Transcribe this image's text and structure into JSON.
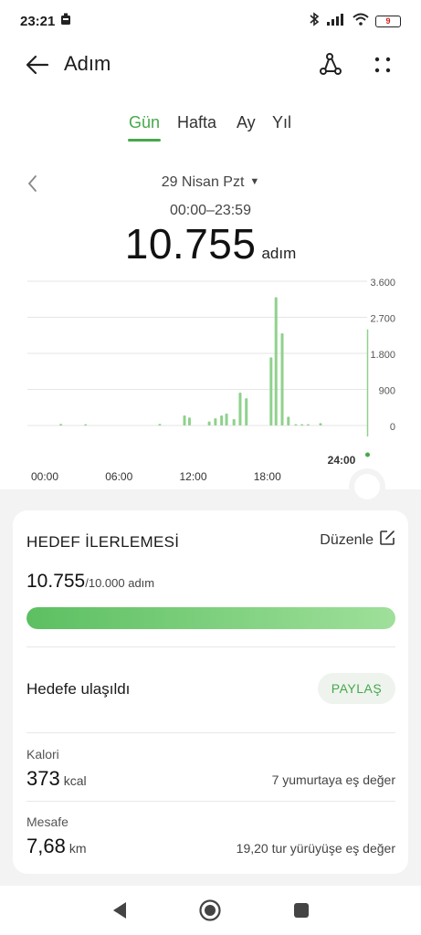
{
  "status_bar": {
    "time": "23:21",
    "battery": "9"
  },
  "app_bar": {
    "title": "Adım"
  },
  "tabs": [
    {
      "label": "Gün",
      "active": true
    },
    {
      "label": "Hafta",
      "active": false
    },
    {
      "label": "Ay",
      "active": false
    },
    {
      "label": "Yıl",
      "active": false
    }
  ],
  "date_nav": {
    "date": "29 Nisan Pzt",
    "time_range": "00:00–23:59"
  },
  "summary": {
    "total_steps": "10.755",
    "unit": "adım"
  },
  "chart_data": {
    "type": "bar",
    "x_tick_labels": [
      "00:00",
      "06:00",
      "12:00",
      "18:00",
      "24:00"
    ],
    "y_tick_labels": [
      "3.600",
      "2.700",
      "1.800",
      "900",
      "0"
    ],
    "ylim": [
      0,
      3600
    ],
    "x_unit_range": [
      0,
      24
    ],
    "bar_color": "#8fd18c",
    "values": [
      {
        "hour": 1.3,
        "steps": 40
      },
      {
        "hour": 3.3,
        "steps": 30
      },
      {
        "hour": 9.3,
        "steps": 40
      },
      {
        "hour": 11.3,
        "steps": 250
      },
      {
        "hour": 11.7,
        "steps": 200
      },
      {
        "hour": 13.3,
        "steps": 100
      },
      {
        "hour": 13.8,
        "steps": 180
      },
      {
        "hour": 14.3,
        "steps": 250
      },
      {
        "hour": 14.7,
        "steps": 300
      },
      {
        "hour": 15.3,
        "steps": 160
      },
      {
        "hour": 15.8,
        "steps": 820
      },
      {
        "hour": 16.3,
        "steps": 680
      },
      {
        "hour": 18.3,
        "steps": 1700
      },
      {
        "hour": 18.7,
        "steps": 3200
      },
      {
        "hour": 19.2,
        "steps": 2300
      },
      {
        "hour": 19.7,
        "steps": 220
      },
      {
        "hour": 20.3,
        "steps": 30
      },
      {
        "hour": 20.8,
        "steps": 30
      },
      {
        "hour": 21.3,
        "steps": 30
      },
      {
        "hour": 22.3,
        "steps": 60
      }
    ],
    "grid": true
  },
  "goal": {
    "title": "HEDEF İLERLEMESİ",
    "edit_label": "Düzenle",
    "current": "10.755",
    "target": "/10.000 adım",
    "progress_fraction": 1.0,
    "reached_label": "Hedefe ulaşıldı",
    "share_label": "PAYLAŞ"
  },
  "calories": {
    "label": "Kalori",
    "value": "373",
    "unit": "kcal",
    "equivalent": "7 yumurtaya eş değer"
  },
  "distance": {
    "label": "Mesafe",
    "value": "7,68",
    "unit": "km",
    "equivalent": "19,20 tur yürüyüşe eş değer"
  },
  "colors": {
    "accent": "#47a84b",
    "bar": "#8fd18c",
    "sheet": "#f3f3f3"
  }
}
